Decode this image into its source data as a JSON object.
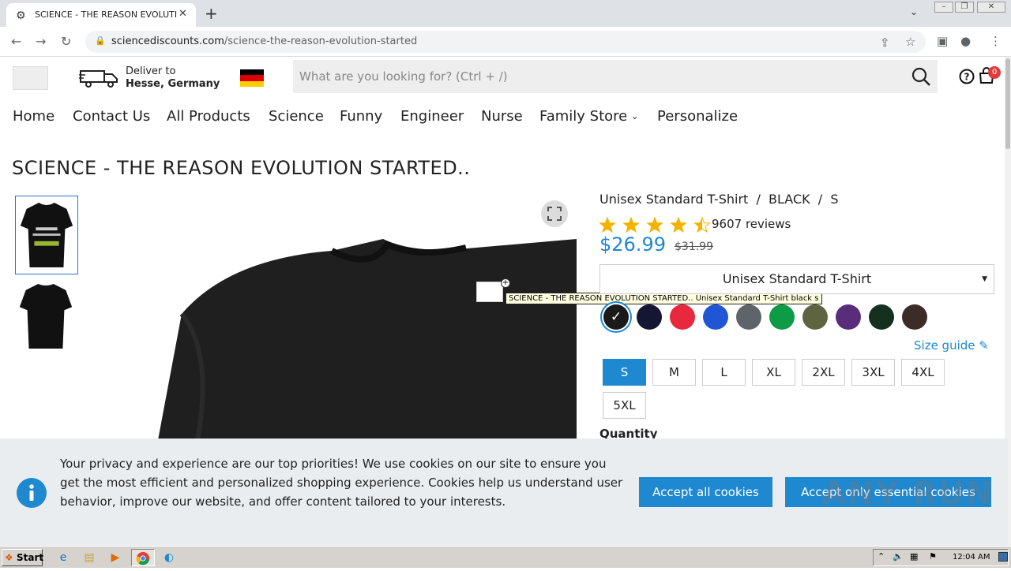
{
  "browser": {
    "tab_title": "SCIENCE - THE REASON EVOLUTION STARTED",
    "url_domain": "sciencediscounts.com",
    "url_path": "/science-the-reason-evolution-started"
  },
  "header": {
    "logo_alt": "logo",
    "deliver_label": "Deliver to",
    "deliver_location": "Hesse, Germany",
    "search_placeholder": "What are you looking for? (Ctrl + /)",
    "cart_count": "0"
  },
  "nav": {
    "items": [
      "Home",
      "Contact Us",
      "All Products",
      "Science",
      "Funny",
      "Engineer",
      "Nurse",
      "Family Store",
      "Personalize"
    ]
  },
  "product": {
    "title": "SCIENCE - THE REASON EVOLUTION STARTED..",
    "variant": "Unisex Standard T-Shirt  /  BLACK  /  S",
    "rating": 4.5,
    "reviews": "9607 reviews",
    "price": "$26.99",
    "old_price": "$31.99",
    "product_type": "Unisex Standard T-Shirt",
    "image_tooltip": "SCIENCE - THE REASON EVOLUTION STARTED.. Unisex Standard T-Shirt black s",
    "colors": [
      "#1a1a1a",
      "#141634",
      "#e8283c",
      "#2056d4",
      "#5e6469",
      "#0e9b45",
      "#5e6340",
      "#5a2d7a",
      "#15301e",
      "#3b2c27"
    ],
    "selected_color_index": 0,
    "size_guide": "Size guide",
    "sizes": [
      "S",
      "M",
      "L",
      "XL",
      "2XL",
      "3XL",
      "4XL",
      "5XL"
    ],
    "selected_size": "S",
    "quantity_label": "Quantity"
  },
  "cookie": {
    "text": "Your privacy and experience are our top priorities! We use cookies on our site to ensure you get the most efficient and personalized shopping experience. Cookies help us understand user behavior, improve our website, and offer content tailored to your interests.",
    "accept_all": "Accept all cookies",
    "accept_essential": "Accept only essential cookies"
  },
  "watermark": "ANY RUN",
  "taskbar": {
    "start": "Start",
    "clock": "12:04 AM"
  }
}
